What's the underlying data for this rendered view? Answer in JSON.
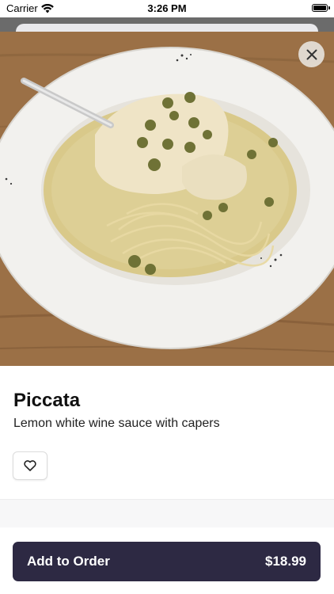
{
  "status_bar": {
    "carrier": "Carrier",
    "time": "3:26 PM"
  },
  "hero": {
    "image_description_icon": "food-photo",
    "close_icon": "close-icon"
  },
  "item": {
    "name": "Piccata",
    "description": "Lemon white wine sauce with capers",
    "favorite_icon": "heart-icon"
  },
  "footer": {
    "add_label": "Add to Order",
    "price": "$18.99"
  },
  "colors": {
    "primary_button": "#2d2943",
    "background": "#ffffff"
  }
}
